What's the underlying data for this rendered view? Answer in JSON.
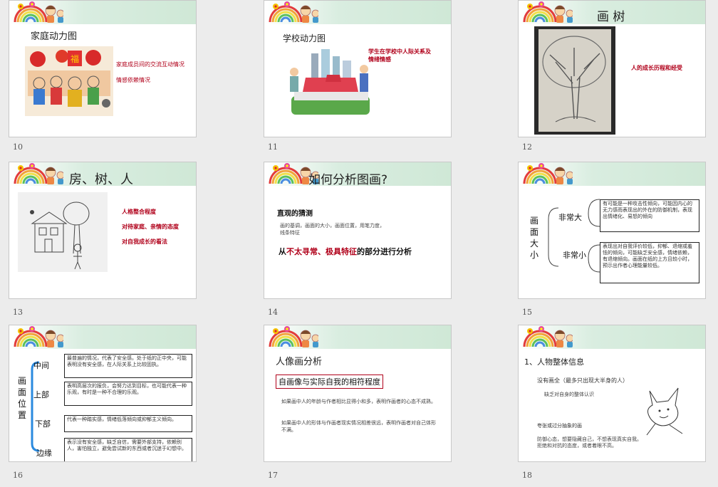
{
  "slides": [
    {
      "num": "10",
      "title": "家庭动力图",
      "notes": [
        "家庭成员间的交流互动情况",
        "情感依赖情况"
      ]
    },
    {
      "num": "11",
      "title": "学校动力图",
      "notes": [
        "学生在学校中人际关系及",
        "情绪情感"
      ]
    },
    {
      "num": "12",
      "title": "画 树",
      "notes": [
        "人的成长历程和经受"
      ]
    },
    {
      "num": "13",
      "title": "房、树、人",
      "notes": [
        "人格整合程度",
        "对待家庭、亲情的态度",
        "对自我成长的看法"
      ]
    },
    {
      "num": "14",
      "title": "如何分析图画?",
      "subtitle": "直观的猜测",
      "desc": [
        "画的基调，画面的大小，画面位置，用笔力度，",
        "线条特征"
      ],
      "emphasis": [
        "从",
        "不太寻常、极具特征",
        "的部分进行分析"
      ]
    },
    {
      "num": "15",
      "vertical_label": "画面大小",
      "branches": [
        {
          "label": "非常大",
          "text": "有可能是一种攻击性倾向，可能因内心的无力感而表现出的外在的防御机制，表现出情绪化、易怒的倾向"
        },
        {
          "label": "非常小",
          "text": "表现出对自我评价较低，抑郁、退缩或羞怯的倾向，可能缺乏安全感，情绪依赖，有退缩倾向。画面在纸的上方且较小时，预示出作者心理能量较低。"
        }
      ]
    },
    {
      "num": "16",
      "vertical_label": "画面位置",
      "branches": [
        {
          "label": "中间",
          "text": "最普遍的情况，代表了安全感。处于纸的正中央，可能表明没有安全感，在人际关系上比较固执。"
        },
        {
          "label": "上部",
          "text": "表明高层次的报负，会努力达到目标，也可能代表一种乐观，有时是一种不合理的乐观。"
        },
        {
          "label": "下部",
          "text": "代表一种踏实感，情绪低落倾向或抑郁主义倾向。"
        },
        {
          "label": "边缘",
          "text": "表示没有安全感，缺乏自信，需要外部支持，依赖别人，害怕独立，避免尝试新的东西或者沉迷于幻想中。"
        }
      ]
    },
    {
      "num": "17",
      "title": "人像画分析",
      "boxed": "自画像与实际自我的相符程度",
      "paras": [
        "如果画中人的年龄与作者相比显得小和多，表明作画者的心态不成熟。",
        "如果画中人的形体与作画者现实情况相差很远，表明作画者对自己体形不满。"
      ]
    },
    {
      "num": "18",
      "title": "1、人物整体信息",
      "lines": [
        "没有画全（最多只出现大半身的人）",
        "缺乏对自身的整体认识",
        "夸张或过分抽象的画",
        "防御心态，想要隐藏自己，不想表现真实自我。",
        "拒绝和对抗的态度，或者着眼不高。"
      ]
    }
  ]
}
